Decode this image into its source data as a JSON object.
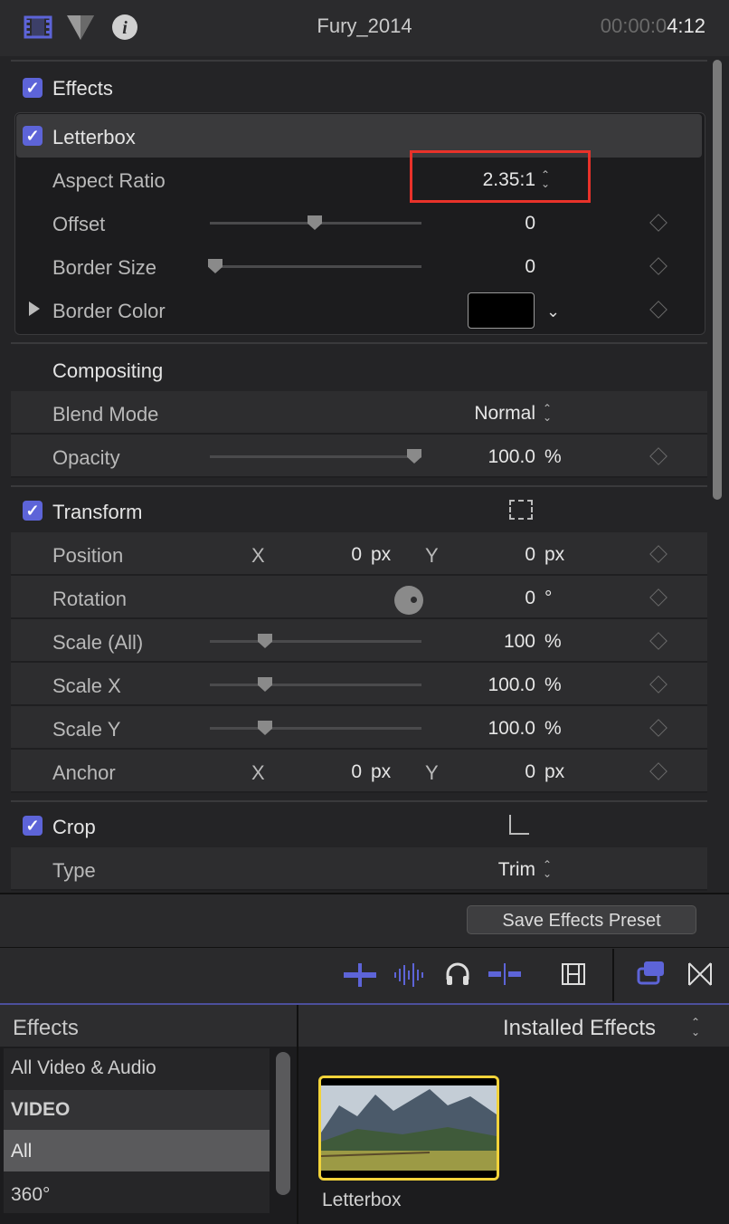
{
  "header": {
    "title": "Fury_2014",
    "timecode_dim": "00:00:0",
    "timecode_bright": "4:12",
    "icons": [
      "film-icon",
      "filter-triangle-icon",
      "info-icon"
    ]
  },
  "effects": {
    "section_label": "Effects",
    "letterbox": {
      "label": "Letterbox",
      "aspect_ratio": {
        "label": "Aspect Ratio",
        "value": "2.35:1"
      },
      "offset": {
        "label": "Offset",
        "value": "0",
        "slider_fraction": 0.5
      },
      "border_size": {
        "label": "Border Size",
        "value": "0",
        "slider_fraction": 0.0
      },
      "border_color": {
        "label": "Border Color",
        "swatch": "#000000"
      }
    }
  },
  "compositing": {
    "label": "Compositing",
    "blend_mode": {
      "label": "Blend Mode",
      "value": "Normal"
    },
    "opacity": {
      "label": "Opacity",
      "value": "100.0",
      "unit": "%",
      "slider_fraction": 1.0
    }
  },
  "transform": {
    "label": "Transform",
    "position": {
      "label": "Position",
      "x_label": "X",
      "x": "0",
      "x_unit": "px",
      "y_label": "Y",
      "y": "0",
      "y_unit": "px"
    },
    "rotation": {
      "label": "Rotation",
      "value": "0",
      "unit": "°"
    },
    "scale_all": {
      "label": "Scale (All)",
      "value": "100",
      "unit": "%"
    },
    "scale_x": {
      "label": "Scale X",
      "value": "100.0",
      "unit": "%"
    },
    "scale_y": {
      "label": "Scale Y",
      "value": "100.0",
      "unit": "%"
    },
    "anchor": {
      "label": "Anchor",
      "x_label": "X",
      "x": "0",
      "x_unit": "px",
      "y_label": "Y",
      "y": "0",
      "y_unit": "px"
    }
  },
  "crop": {
    "label": "Crop",
    "type": {
      "label": "Type",
      "value": "Trim"
    }
  },
  "save_preset_label": "Save Effects Preset",
  "browser": {
    "left_header": "Effects",
    "right_header": "Installed Effects",
    "categories": [
      "All Video & Audio",
      "VIDEO",
      "All",
      "360°"
    ],
    "thumbnail_label": "Letterbox"
  },
  "colors": {
    "accent": "#5d64d8",
    "highlight_box": "#e8322a",
    "thumb_border": "#f2d33a"
  }
}
